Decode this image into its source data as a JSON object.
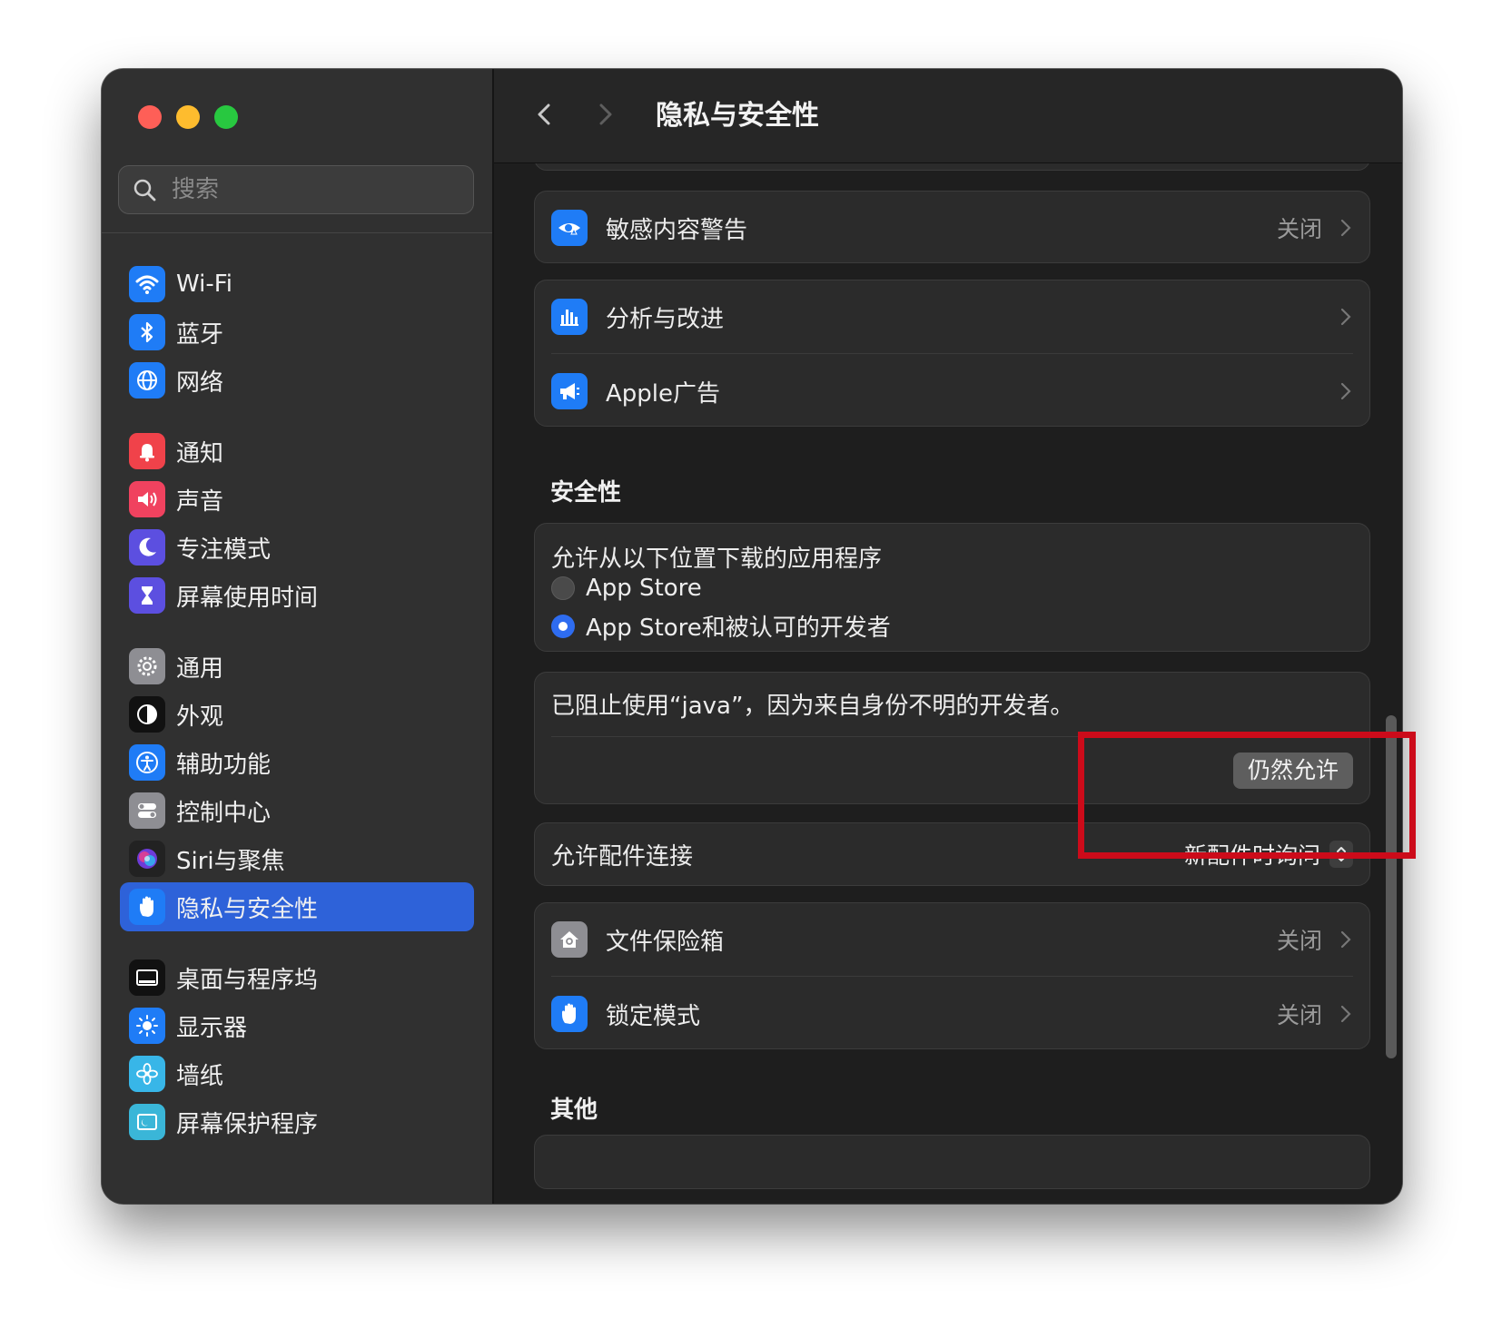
{
  "window": {
    "title": "隐私与安全性",
    "traffic_lights": [
      "#fe5f57",
      "#febc2e",
      "#28c840"
    ]
  },
  "search": {
    "placeholder": "搜索"
  },
  "sidebar": {
    "items": [
      {
        "label": "Wi-Fi",
        "icon": "wifi-icon",
        "color": "#1f7cf6"
      },
      {
        "label": "蓝牙",
        "icon": "bluetooth-icon",
        "color": "#1f7cf6"
      },
      {
        "label": "网络",
        "icon": "globe-icon",
        "color": "#1f7cf6"
      },
      {
        "label": "通知",
        "icon": "bell-icon",
        "color": "#f0424a"
      },
      {
        "label": "声音",
        "icon": "speaker-icon",
        "color": "#f0425f"
      },
      {
        "label": "专注模式",
        "icon": "moon-icon",
        "color": "#5c4fe0"
      },
      {
        "label": "屏幕使用时间",
        "icon": "hourglass-icon",
        "color": "#5c4fe0"
      },
      {
        "label": "通用",
        "icon": "gear-icon",
        "color": "#8e8e93"
      },
      {
        "label": "外观",
        "icon": "appearance-icon",
        "color": "#111111"
      },
      {
        "label": "辅助功能",
        "icon": "accessibility-icon",
        "color": "#1f7cf6"
      },
      {
        "label": "控制中心",
        "icon": "toggles-icon",
        "color": "#8e8e93"
      },
      {
        "label": "Siri与聚焦",
        "icon": "siri-icon",
        "color": "#222222"
      },
      {
        "label": "隐私与安全性",
        "icon": "hand-icon",
        "color": "#1f7cf6",
        "selected": true
      },
      {
        "label": "桌面与程序坞",
        "icon": "dock-icon",
        "color": "#111111"
      },
      {
        "label": "显示器",
        "icon": "sun-icon",
        "color": "#1f7cf6"
      },
      {
        "label": "墙纸",
        "icon": "flower-icon",
        "color": "#38b6e8"
      },
      {
        "label": "屏幕保护程序",
        "icon": "screensaver-icon",
        "color": "#3ab6d8"
      }
    ]
  },
  "main": {
    "sensitive": {
      "label": "敏感内容警告",
      "value": "关闭",
      "icon": "eye-warning-icon"
    },
    "analytics": {
      "label": "分析与改进",
      "icon": "bar-chart-icon"
    },
    "ads": {
      "label": "Apple广告",
      "icon": "megaphone-icon"
    },
    "security_title": "安全性",
    "download": {
      "label": "允许从以下位置下载的应用程序",
      "options": [
        "App Store",
        "App Store和被认可的开发者"
      ],
      "selected_index": 1
    },
    "blocked": {
      "message": "已阻止使用“java”，因为来自身份不明的开发者。",
      "button": "仍然允许"
    },
    "accessory": {
      "label": "允许配件连接",
      "value": "新配件时询问"
    },
    "filevault": {
      "label": "文件保险箱",
      "value": "关闭",
      "icon": "house-lock-icon"
    },
    "lockdown": {
      "label": "锁定模式",
      "value": "关闭",
      "icon": "hand-icon"
    },
    "other_title": "其他"
  },
  "annotation_color": "#cc0b1a"
}
